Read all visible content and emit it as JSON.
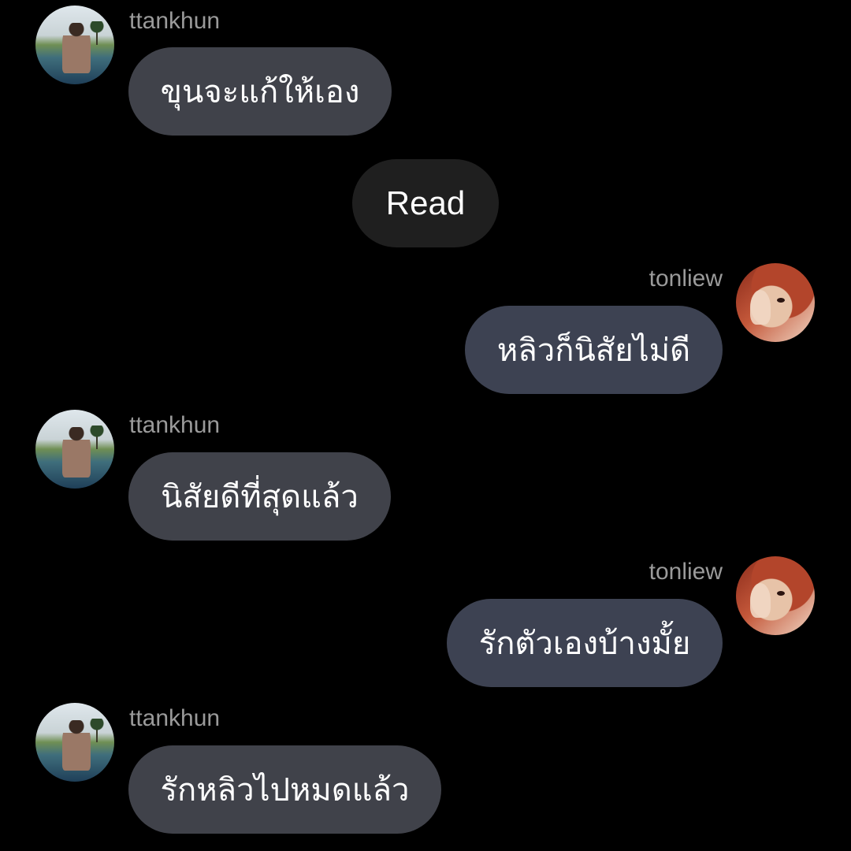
{
  "conversation": {
    "status_pill": "Read",
    "watermark_lines": [],
    "messages": [
      {
        "sender": "ttankhun",
        "side": "left",
        "text": "ขุนจะแก้ให้เอง"
      },
      {
        "sender": "tonliew",
        "side": "right",
        "text": "หลิวก็นิสัยไม่ดี"
      },
      {
        "sender": "ttankhun",
        "side": "left",
        "text": "นิสัยดีที่สุดแล้ว"
      },
      {
        "sender": "tonliew",
        "side": "right",
        "text": "รักตัวเองบ้างมั้ย"
      },
      {
        "sender": "ttankhun",
        "side": "left",
        "text": "รักหลิวไปหมดแล้ว"
      }
    ]
  },
  "avatars": {
    "ttankhun": "beach-pool-photo-avatar",
    "tonliew": "red-hair-portrait-avatar"
  },
  "colors": {
    "background": "#000000",
    "bubble_left": "#40424a",
    "bubble_right": "#3d4252",
    "read_pill": "#1f1f1f",
    "username": "#9a9a9a",
    "text": "#ffffff"
  }
}
